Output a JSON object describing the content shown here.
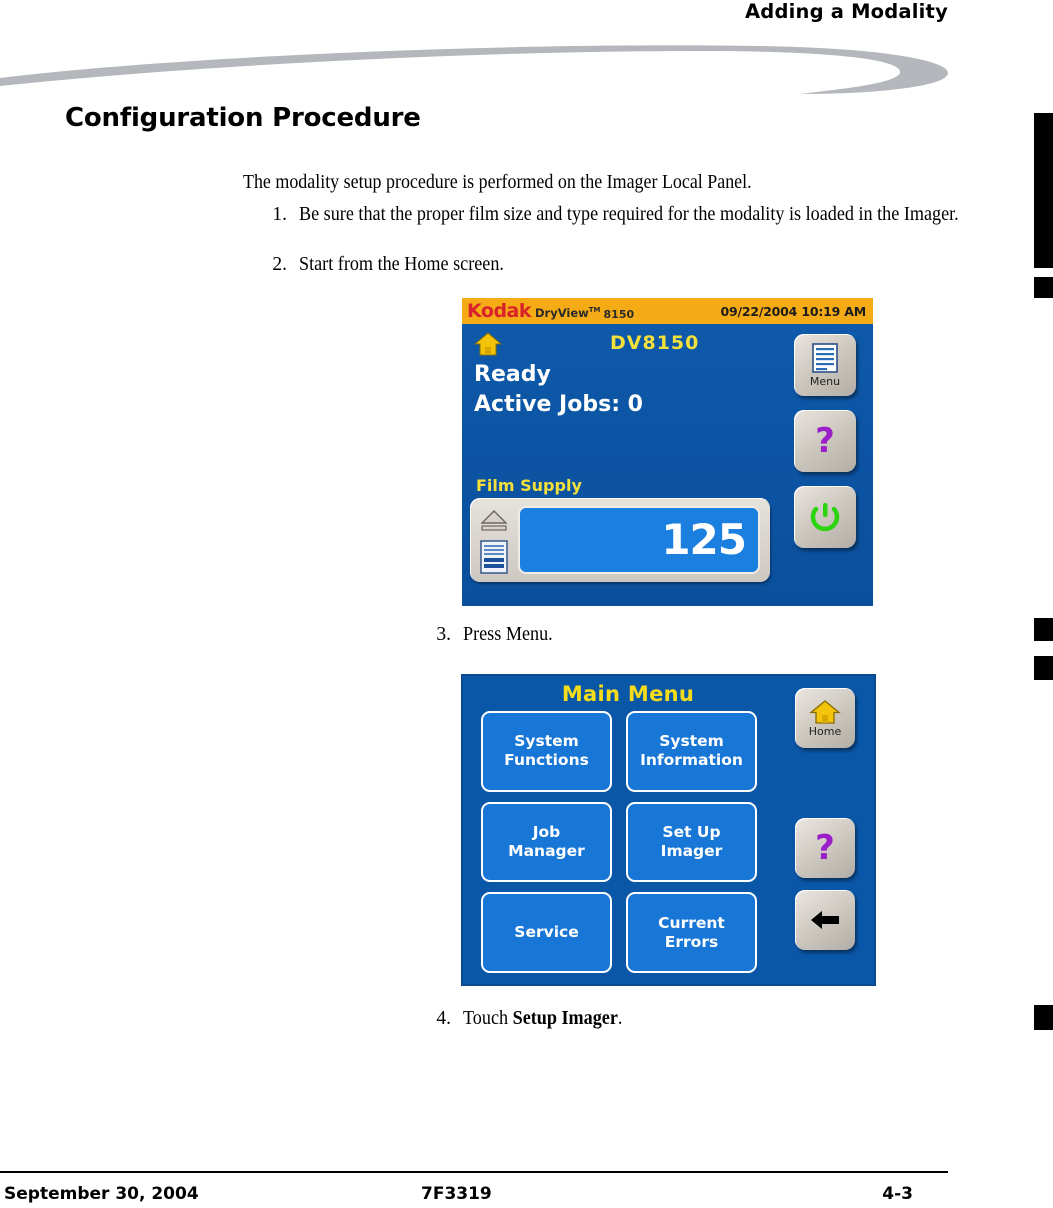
{
  "running_head": "Adding a Modality",
  "section_heading": "Configuration Procedure",
  "lead_paragraph": "The modality setup procedure is performed on the Imager Local Panel.",
  "steps": [
    {
      "num": "1.",
      "text": "Be sure that the proper film size and type required for the modality is loaded in the Imager."
    },
    {
      "num": "2.",
      "text": "Start from the Home screen."
    },
    {
      "num": "3.",
      "text": "Press Menu."
    },
    {
      "num": "4.",
      "text_prefix": "Touch ",
      "text_bold": "Setup Imager",
      "text_suffix": "."
    }
  ],
  "home_screen": {
    "brand": "Kodak",
    "product": "DryView",
    "trademark": "TM",
    "model_small": "8150",
    "datetime": "09/22/2004 10:19 AM",
    "device_name": "DV8150",
    "status": "Ready",
    "active_jobs": "Active Jobs: 0",
    "film_supply_label": "Film Supply",
    "film_count": "125",
    "buttons": [
      {
        "name": "menu-button",
        "label": "Menu",
        "icon": "document-lines-icon"
      },
      {
        "name": "help-button",
        "label": "",
        "icon": "question-mark-icon"
      },
      {
        "name": "power-button",
        "label": "",
        "icon": "power-icon"
      }
    ],
    "colors": {
      "titlebar": "#f5ab16",
      "brand_red": "#d8232a",
      "panel_blue": "#0a57a8",
      "accent_yellow": "#f3e03a",
      "count_box_blue": "#1b7fe0"
    }
  },
  "main_menu": {
    "title": "Main Menu",
    "buttons": [
      "System\nFunctions",
      "System\nInformation",
      "Job\nManager",
      "Set Up\nImager",
      "Service",
      "Current\nErrors"
    ],
    "side_buttons": [
      {
        "name": "home-button",
        "label": "Home",
        "icon": "house-icon"
      },
      {
        "name": "help-button",
        "label": "",
        "icon": "question-mark-icon"
      },
      {
        "name": "back-button",
        "label": "",
        "icon": "arrow-left-icon"
      }
    ],
    "colors": {
      "panel_blue": "#0a57a8",
      "button_blue": "#1877d6",
      "title_yellow": "#f6dc1a"
    }
  },
  "footer": {
    "date": "September 30, 2004",
    "doc_number": "7F3319",
    "page_number": "4-3"
  }
}
